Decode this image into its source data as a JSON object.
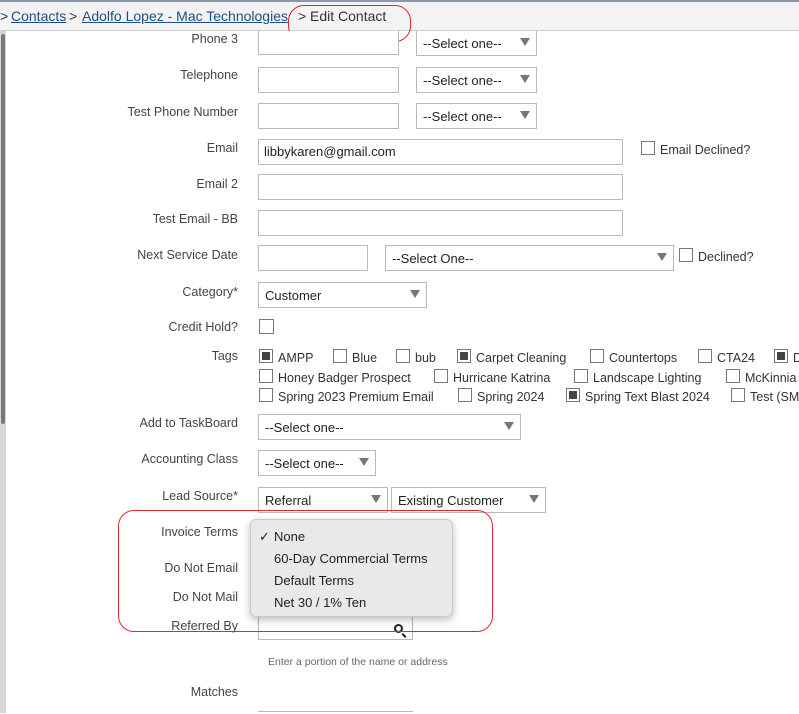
{
  "breadcrumb": {
    "lead": ">",
    "contacts": "Contacts",
    "sep1": ">",
    "contact_name": "Adolfo Lopez - Mac Technologies",
    "sep2": ">",
    "current": "Edit Contact"
  },
  "fields": {
    "phone3": {
      "label": "Phone 3",
      "value": "",
      "type_select": "--Select one--"
    },
    "telephone": {
      "label": "Telephone",
      "value": "",
      "type_select": "--Select one--"
    },
    "test_phone": {
      "label": "Test Phone Number",
      "value": "",
      "type_select": "--Select one--"
    },
    "email": {
      "label": "Email",
      "value": "libbykaren@gmail.com",
      "declined_label": "Email Declined?",
      "declined": false
    },
    "email2": {
      "label": "Email 2",
      "value": ""
    },
    "test_email": {
      "label": "Test Email - BB",
      "value": ""
    },
    "next_service": {
      "label": "Next Service Date",
      "value": "",
      "select": "--Select One--",
      "declined_label": "Declined?",
      "declined": false
    },
    "category": {
      "label": "Category*",
      "value": "Customer"
    },
    "credit_hold": {
      "label": "Credit Hold?",
      "checked": false
    },
    "tags": {
      "label": "Tags",
      "items": [
        {
          "label": "AMPP",
          "checked": true
        },
        {
          "label": "Blue",
          "checked": false
        },
        {
          "label": "bub",
          "checked": false
        },
        {
          "label": "Carpet Cleaning",
          "checked": true
        },
        {
          "label": "Countertops",
          "checked": false
        },
        {
          "label": "CTA24",
          "checked": false
        },
        {
          "label": "D",
          "checked": true
        },
        {
          "label": "Honey Badger Prospect",
          "checked": false
        },
        {
          "label": "Hurricane Katrina",
          "checked": false
        },
        {
          "label": "Landscape Lighting",
          "checked": false
        },
        {
          "label": "McKinnia",
          "checked": false
        },
        {
          "label": "Spring 2023 Premium Email",
          "checked": false
        },
        {
          "label": "Spring 2024",
          "checked": false
        },
        {
          "label": "Spring Text Blast 2024",
          "checked": true
        },
        {
          "label": "Test (SM",
          "checked": false
        }
      ]
    },
    "taskboard": {
      "label": "Add to TaskBoard",
      "value": "--Select one--"
    },
    "accounting_class": {
      "label": "Accounting Class",
      "value": "--Select one--"
    },
    "lead_source": {
      "label": "Lead Source*",
      "value": "Referral",
      "sub_value": "Existing Customer"
    },
    "invoice_terms": {
      "label": "Invoice Terms",
      "options": [
        "None",
        "60-Day Commercial Terms",
        "Default Terms",
        "Net 30 / 1% Ten"
      ],
      "selected": "None",
      "check_glyph": "✓"
    },
    "do_not_email": {
      "label": "Do Not Email"
    },
    "do_not_mail": {
      "label": "Do Not Mail"
    },
    "referred_by": {
      "label": "Referred By",
      "value": "",
      "hint": "Enter a portion of the name or address"
    },
    "matches": {
      "label": "Matches"
    }
  },
  "colors": {
    "link": "#1a4f8a",
    "highlight": "#e0262b",
    "dropdown_bg": "#e9e9e9"
  }
}
